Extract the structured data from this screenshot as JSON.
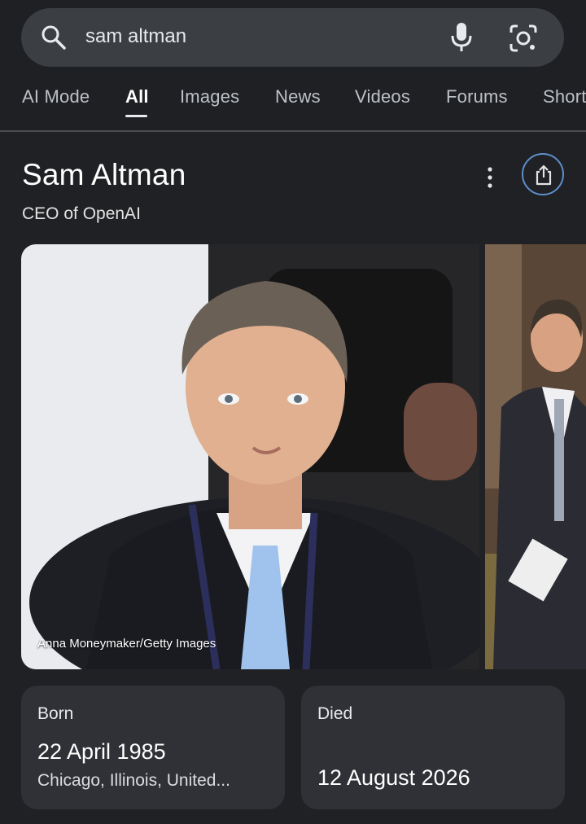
{
  "search": {
    "query": "sam altman",
    "icons": [
      "search-icon",
      "mic-icon",
      "google-lens-icon"
    ]
  },
  "tabs": [
    "AI Mode",
    "All",
    "Images",
    "News",
    "Videos",
    "Forums",
    "Short"
  ],
  "active_tab": "All",
  "knowledge_panel": {
    "title": "Sam Altman",
    "subtitle": "CEO of OpenAI",
    "photo_credit": "Anna Moneymaker/Getty Images",
    "born": {
      "label": "Born",
      "date": "22 April 1985",
      "place": "Chicago, Illinois, United..."
    },
    "died": {
      "label": "Died",
      "date": "12 August 2026"
    }
  },
  "colors": {
    "background": "#202124",
    "search_bar": "#3b3e43",
    "card": "#303136",
    "share_border": "#5e8ecb"
  }
}
